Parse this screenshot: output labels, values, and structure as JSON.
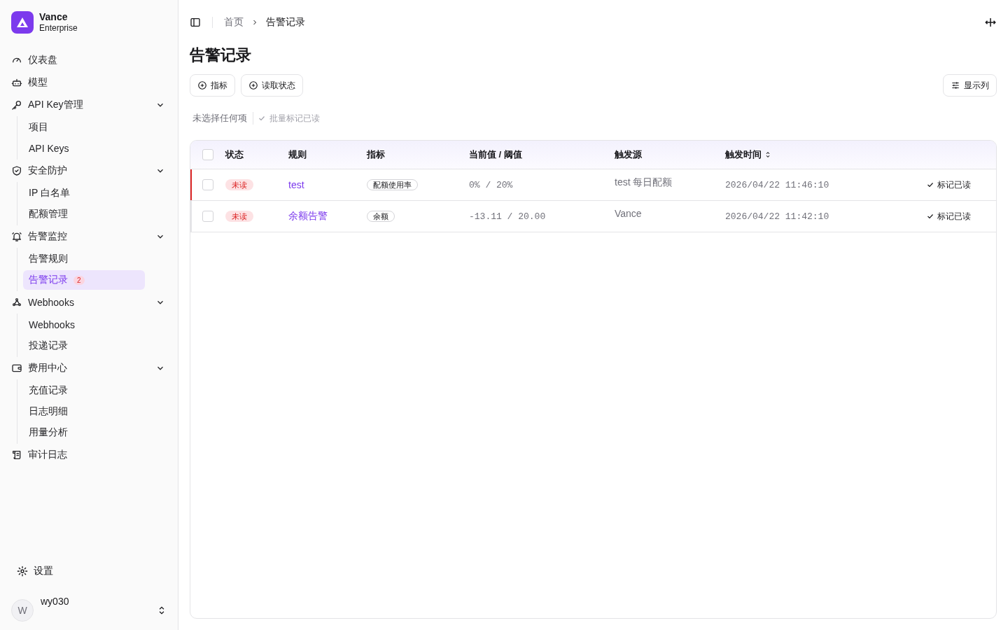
{
  "brand": {
    "name": "Vance",
    "plan": "Enterprise"
  },
  "sidebar": {
    "items": [
      {
        "label": "仪表盘",
        "selected": false
      },
      {
        "label": "模型",
        "selected": false
      },
      {
        "label": "API Key管理",
        "expanded": true,
        "children": [
          {
            "label": "项目",
            "selected": false
          },
          {
            "label": "API Keys",
            "selected": false
          }
        ]
      },
      {
        "label": "安全防护",
        "expanded": true,
        "children": [
          {
            "label": "IP 白名单",
            "selected": false
          },
          {
            "label": "配额管理",
            "selected": false
          }
        ]
      },
      {
        "label": "告警监控",
        "expanded": true,
        "children": [
          {
            "label": "告警规则",
            "selected": false
          },
          {
            "label": "告警记录",
            "selected": true,
            "badge": "2"
          }
        ]
      },
      {
        "label": "Webhooks",
        "expanded": true,
        "children": [
          {
            "label": "Webhooks",
            "selected": false
          },
          {
            "label": "投递记录",
            "selected": false
          }
        ]
      },
      {
        "label": "费用中心",
        "expanded": true,
        "children": [
          {
            "label": "充值记录",
            "selected": false
          },
          {
            "label": "日志明细",
            "selected": false
          },
          {
            "label": "用量分析",
            "selected": false
          }
        ]
      },
      {
        "label": "审计日志",
        "selected": false
      }
    ],
    "settings": "设置",
    "user": {
      "avatar": "W",
      "name": "wy030"
    }
  },
  "breadcrumb": [
    "首页",
    "告警记录"
  ],
  "page_title": "告警记录",
  "filters": [
    "指标",
    "读取状态"
  ],
  "columns_button": "显示列",
  "selection": {
    "text": "未选择任何项",
    "bulk_action": "批量标记已读",
    "bulk_disabled": true
  },
  "table": {
    "select_all_checked": false,
    "columns": [
      "状态",
      "规则",
      "指标",
      "当前值 / 阈值",
      "触发源",
      "触发时间"
    ],
    "rows": [
      {
        "checked": false,
        "highlighted": true,
        "status": "未读",
        "rule": "test",
        "metric": "配额使用率",
        "value": "0% / 20%",
        "source": "test 每日配额",
        "time": "2026/04/22 11:46:10",
        "action": "标记已读"
      },
      {
        "checked": false,
        "highlighted": false,
        "status": "未读",
        "rule": "余额告警",
        "metric": "余额",
        "value": "-13.11 / 20.00",
        "source": "Vance",
        "time": "2026/04/22 11:42:10",
        "action": "标记已读"
      }
    ]
  }
}
